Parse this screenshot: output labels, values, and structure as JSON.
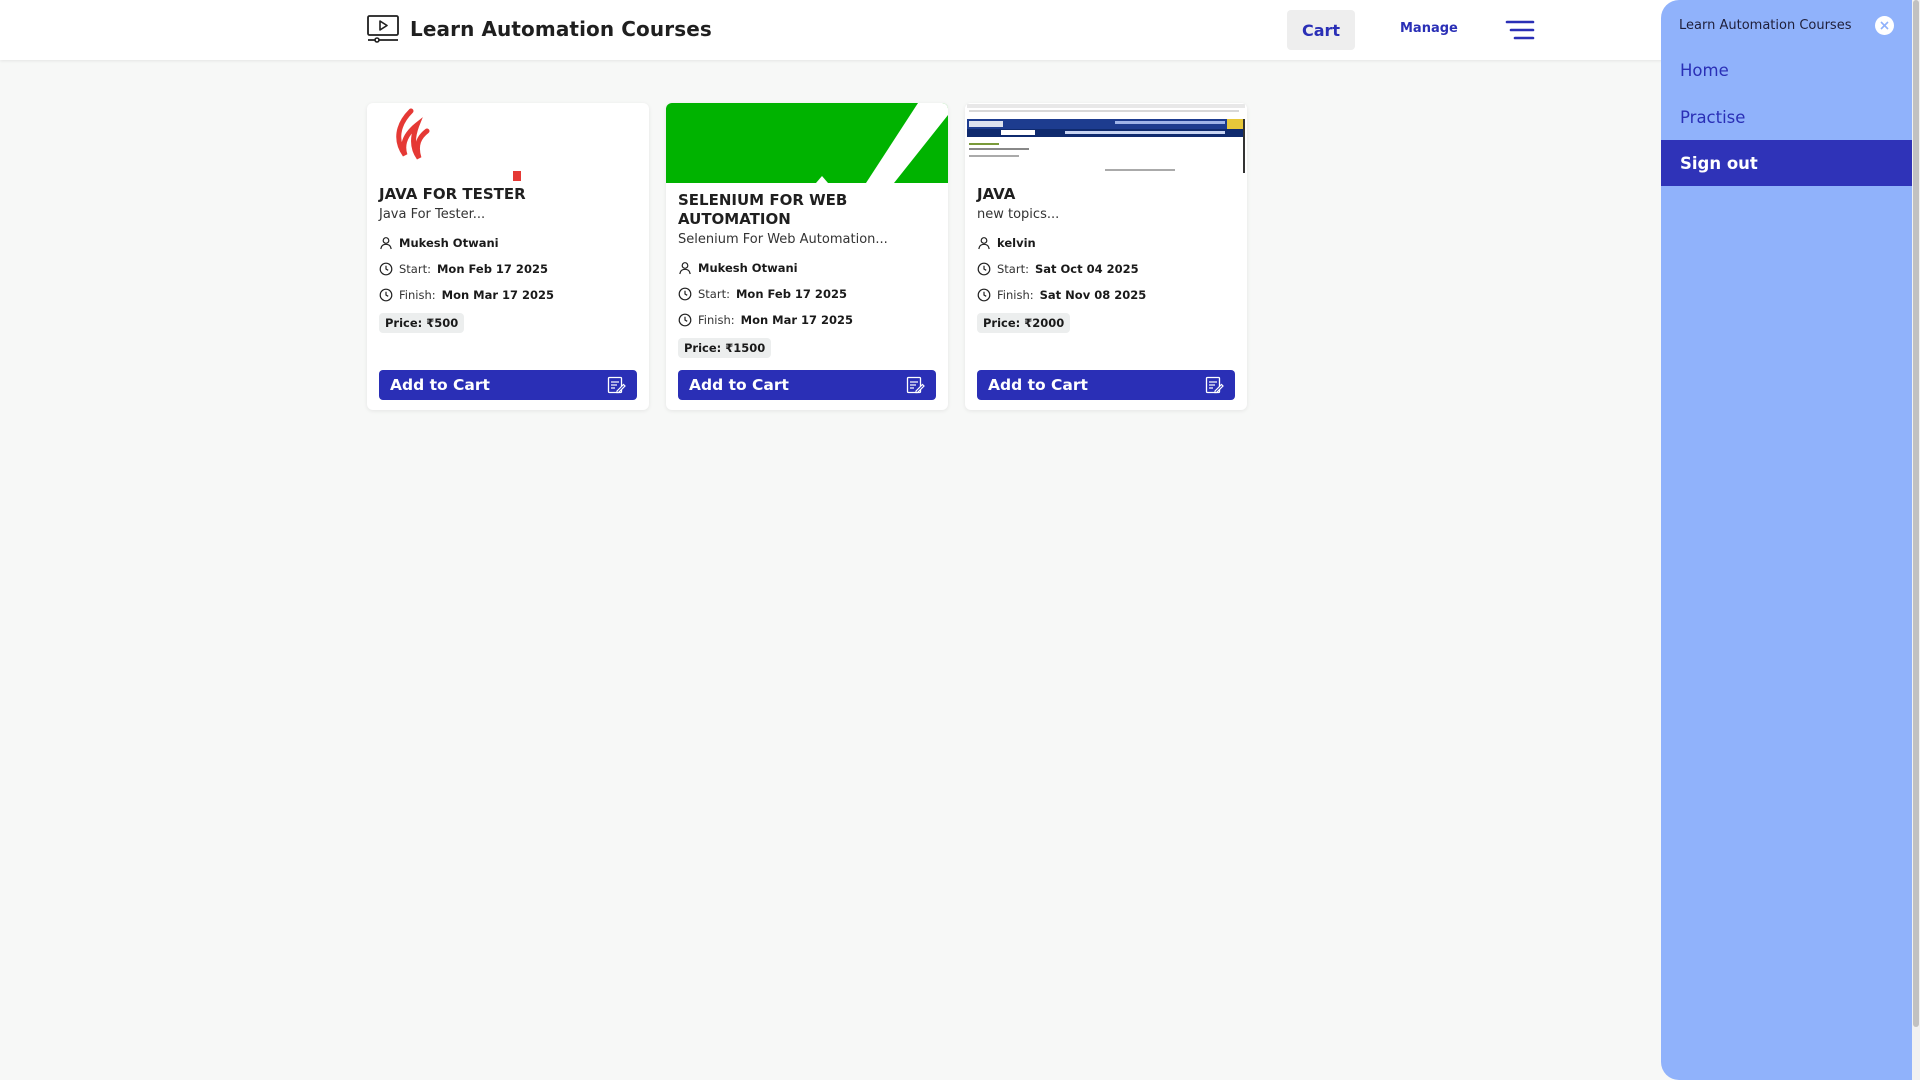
{
  "header": {
    "brand_title": "Learn Automation Courses",
    "cart_label": "Cart",
    "manage_label": "Manage"
  },
  "courses": [
    {
      "title": "JAVA FOR TESTER",
      "description": "Java For Tester...",
      "instructor": "Mukesh Otwani",
      "start_label": "Start:",
      "start_date": "Mon Feb 17 2025",
      "finish_label": "Finish:",
      "finish_date": "Mon Mar 17 2025",
      "price": "Price: ₹500",
      "button_label": "Add to Cart"
    },
    {
      "title": "SELENIUM FOR WEB AUTOMATION",
      "description": "Selenium For Web Automation...",
      "instructor": "Mukesh Otwani",
      "start_label": "Start:",
      "start_date": "Mon Feb 17 2025",
      "finish_label": "Finish:",
      "finish_date": "Mon Mar 17 2025",
      "price": "Price: ₹1500",
      "button_label": "Add to Cart"
    },
    {
      "title": "JAVA",
      "description": "new topics...",
      "instructor": "kelvin",
      "start_label": "Start:",
      "start_date": "Sat Oct 04 2025",
      "finish_label": "Finish:",
      "finish_date": "Sat Nov 08 2025",
      "price": "Price: ₹2000",
      "button_label": "Add to Cart"
    }
  ],
  "drawer": {
    "title": "Learn Automation Courses",
    "items": [
      {
        "label": "Home"
      },
      {
        "label": "Practise"
      },
      {
        "label": "Sign out"
      }
    ]
  },
  "icons": {
    "brand": "monitor-play-icon",
    "menu": "hamburger-menu-icon",
    "instructor": "user-icon",
    "date": "clock-icon",
    "cart": "edit-note-icon",
    "close": "close-icon"
  },
  "colors": {
    "accent": "#2a2fb6",
    "drawer_bg": "#90b2fb",
    "page_bg": "#f7f8f7",
    "selenium_green": "#00b300",
    "java_red": "#e53935"
  }
}
